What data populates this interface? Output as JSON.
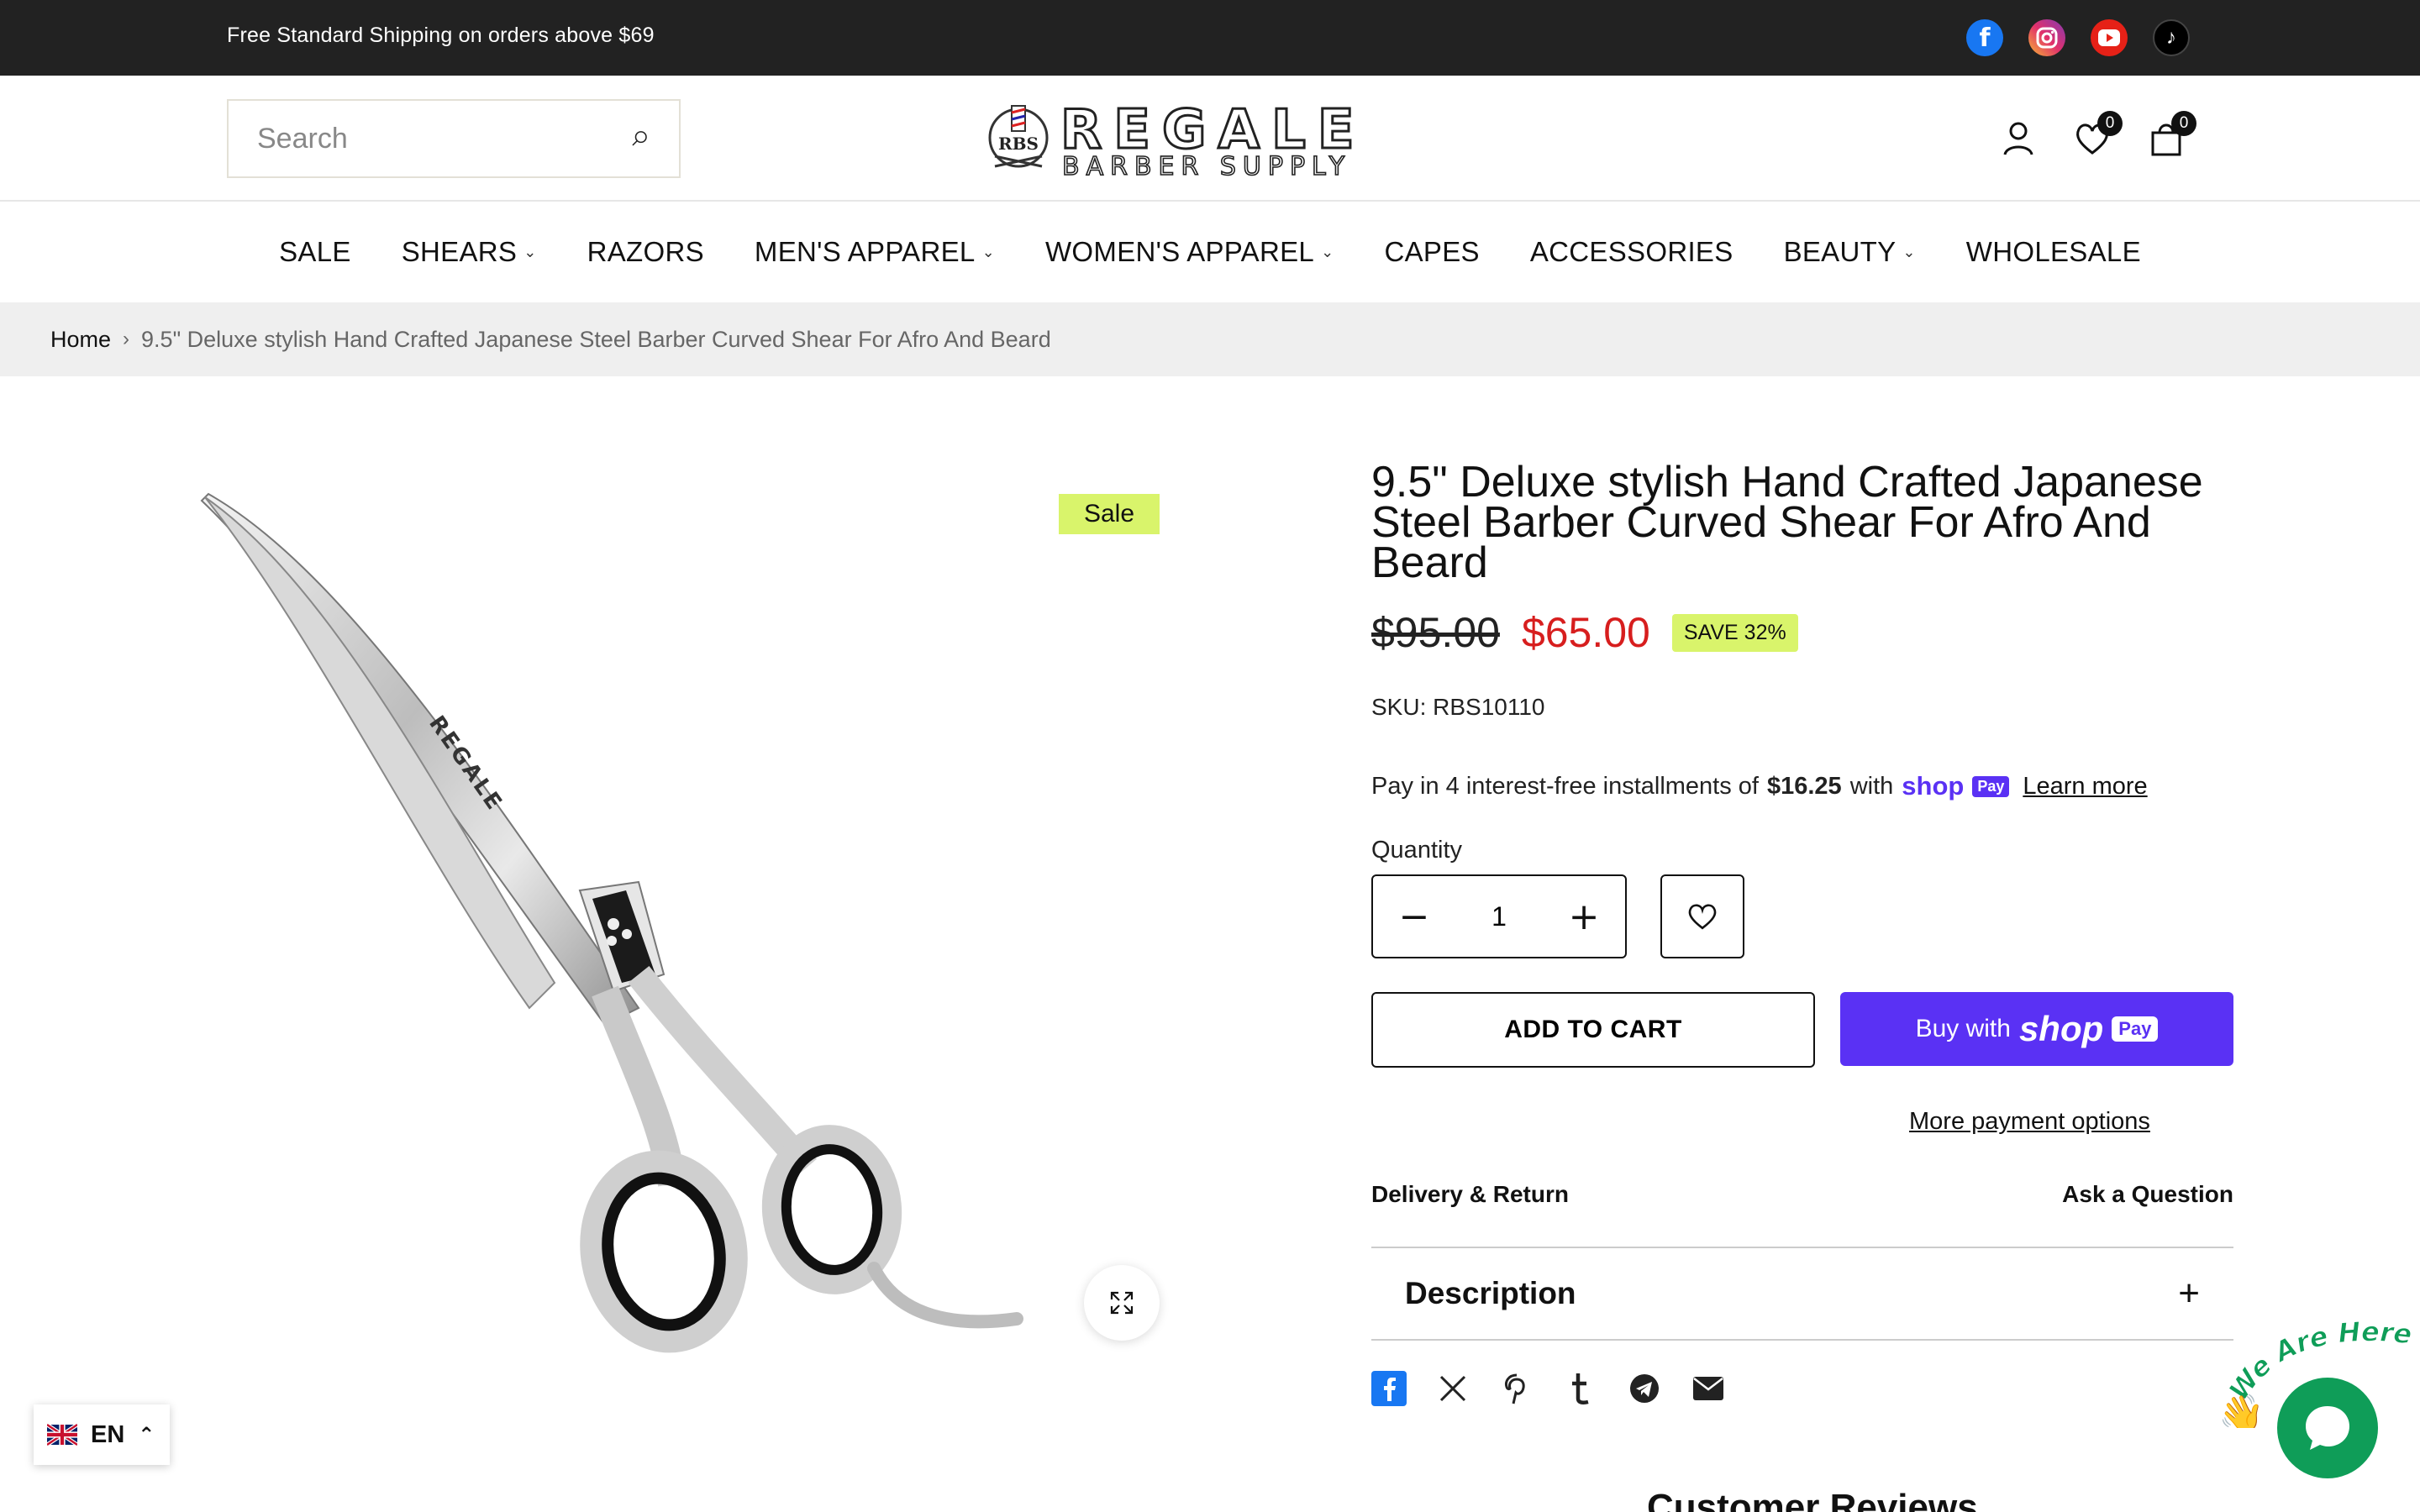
{
  "topbar": {
    "announcement": "Free Standard Shipping on orders above $69",
    "socials": [
      {
        "icon": "facebook-icon",
        "glyph": "f",
        "color": "#1877f2"
      },
      {
        "icon": "instagram-icon",
        "glyph": "◎",
        "color": "#e1306c"
      },
      {
        "icon": "youtube-icon",
        "glyph": "▶",
        "color": "#e62117"
      },
      {
        "icon": "tiktok-icon",
        "glyph": "♪",
        "color": "#000000"
      }
    ]
  },
  "header": {
    "search_placeholder": "Search",
    "logo": {
      "brand": "REGALE",
      "sub": "BARBER SUPPLY",
      "mark": "RBS"
    },
    "wishlist_count": "0",
    "cart_count": "0"
  },
  "nav": {
    "items": [
      {
        "label": "SALE",
        "dropdown": false
      },
      {
        "label": "SHEARS",
        "dropdown": true
      },
      {
        "label": "RAZORS",
        "dropdown": false
      },
      {
        "label": "MEN'S APPAREL",
        "dropdown": true
      },
      {
        "label": "WOMEN'S APPAREL",
        "dropdown": true
      },
      {
        "label": "CAPES",
        "dropdown": false
      },
      {
        "label": "ACCESSORIES",
        "dropdown": false
      },
      {
        "label": "BEAUTY",
        "dropdown": true
      },
      {
        "label": "WHOLESALE",
        "dropdown": false
      }
    ]
  },
  "breadcrumb": {
    "home": "Home",
    "current": "9.5\" Deluxe stylish Hand Crafted Japanese Steel Barber Curved Shear For Afro And Beard"
  },
  "gallery": {
    "sale_badge": "Sale",
    "engraving": "REGALE"
  },
  "product": {
    "title": "9.5\" Deluxe stylish Hand Crafted Japanese Steel Barber Curved Shear For Afro And Beard",
    "compare_price": "$95.00",
    "price": "$65.00",
    "save_badge": "SAVE 32%",
    "sku": "SKU: RBS10110",
    "installments": {
      "prefix": "Pay in 4 interest-free installments of",
      "amount": "$16.25",
      "with": "with",
      "shop": "shop",
      "pay": "Pay",
      "learn_more": "Learn more"
    },
    "quantity_label": "Quantity",
    "quantity_value": "1",
    "add_to_cart": "ADD TO CART",
    "buy_with": "Buy with",
    "buy_shop": "shop",
    "buy_pay": "Pay",
    "more_payment": "More payment options",
    "delivery_return": "Delivery & Return",
    "ask_question": "Ask a Question",
    "description_label": "Description",
    "share_icons": [
      "facebook-share-icon",
      "x-share-icon",
      "pinterest-share-icon",
      "tumblr-share-icon",
      "telegram-share-icon",
      "email-share-icon"
    ],
    "customer_reviews": "Customer Reviews"
  },
  "language": {
    "code": "EN"
  },
  "chat": {
    "label": "We Are Here!",
    "wave": "👋"
  },
  "colors": {
    "accent_purple": "#5a31f4",
    "sale_red": "#d71e1e",
    "badge_lime": "#d9f46b",
    "topbar": "#222222",
    "chat_green": "#0f9d58"
  }
}
